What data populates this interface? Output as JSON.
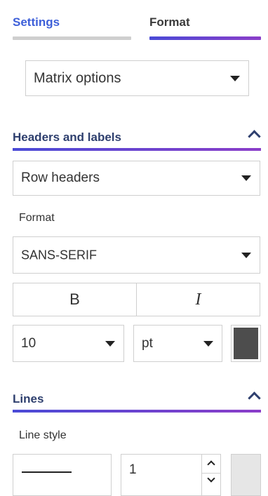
{
  "tabs": [
    {
      "label": "Settings",
      "active": false
    },
    {
      "label": "Format",
      "active": true
    }
  ],
  "matrix_select": {
    "value": "Matrix options"
  },
  "sections": {
    "headers": {
      "title": "Headers and labels",
      "target_select": "Row headers",
      "format_label": "Format",
      "font_select": "SANS-SERIF",
      "bold_label": "B",
      "italic_label": "I",
      "size_select": "10",
      "unit_select": "pt",
      "font_color": "#4d4d4d"
    },
    "lines": {
      "title": "Lines",
      "line_style_label": "Line style",
      "line_width": "1",
      "line_color": "#e6e6e6"
    }
  },
  "colors": {
    "accent": "#3d5fd9",
    "gradient_start": "#4a4ad6",
    "gradient_end": "#8b3ec9",
    "section_title": "#2e3f6e"
  }
}
